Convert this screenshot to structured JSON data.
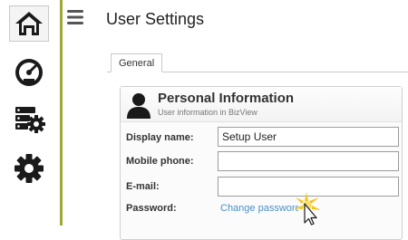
{
  "sidebar": {
    "accent_color": "#9ea837",
    "items": [
      {
        "icon": "home-icon",
        "active": true
      },
      {
        "icon": "dashboard-gauge-icon",
        "active": false
      },
      {
        "icon": "server-settings-icon",
        "active": false
      },
      {
        "icon": "gear-icon",
        "active": false
      }
    ]
  },
  "header": {
    "menu_icon": "hamburger-menu-icon",
    "title": "User Settings"
  },
  "tabs": [
    {
      "label": "General",
      "selected": true
    }
  ],
  "panel": {
    "icon": "user-icon",
    "title": "Personal Information",
    "subtitle": "User information in BizView",
    "fields": {
      "display_name": {
        "label": "Display name:",
        "value": "Setup User"
      },
      "mobile_phone": {
        "label": "Mobile phone:",
        "value": ""
      },
      "email": {
        "label": "E-mail:",
        "value": ""
      },
      "password": {
        "label": "Password:",
        "link_text": "Change password"
      }
    }
  },
  "colors": {
    "link": "#4a8fc4",
    "cursor_highlight": "#f5c518"
  }
}
